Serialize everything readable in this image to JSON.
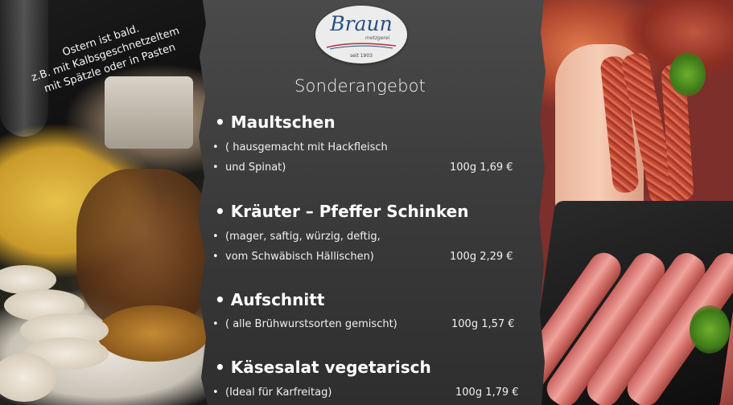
{
  "left_photo": {
    "note_lines": [
      "Ostern ist bald.",
      "z.B. mit Kalbsgeschnetzeltem",
      "mit Spätzle oder in Pasten"
    ]
  },
  "logo": {
    "name": "Braun",
    "subtitle": "metzgerei",
    "since": "seit 1903",
    "colors": {
      "script": "#2b4f82",
      "swoosh": "#b23a4a",
      "background": "#ececec"
    }
  },
  "menu": {
    "heading": "Sonderangebot",
    "items": [
      {
        "title": "Maultschen",
        "lines": [
          "( hausgemacht mit Hackfleisch",
          "und Spinat)"
        ],
        "price": "100g 1,69  €"
      },
      {
        "title": "Kräuter – Pfeffer Schinken",
        "lines": [
          "(mager, saftig, würzig, deftig,",
          "vom Schwäbisch Hällischen)"
        ],
        "price": "100g 2,29 €"
      },
      {
        "title": "Aufschnitt",
        "lines": [
          "( alle Brühwurstsorten gemischt)"
        ],
        "price": "100g  1,57 €"
      },
      {
        "title": "Käsesalat vegetarisch",
        "lines": [
          "(Ideal für Karfreitag)"
        ],
        "price": "100g 1,79 €"
      }
    ],
    "colors": {
      "panel": "#3c3c3c",
      "text": "#ffffff"
    }
  }
}
